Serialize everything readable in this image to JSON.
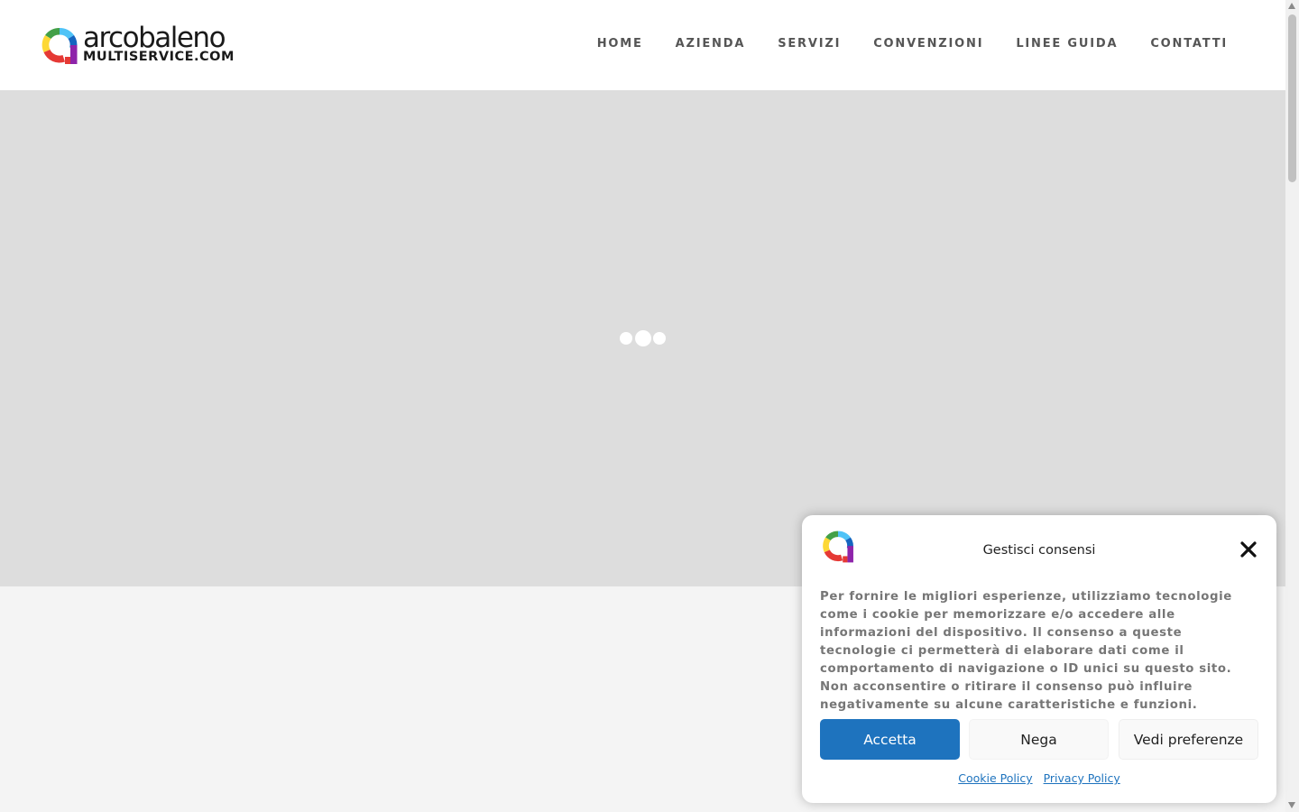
{
  "brand": {
    "name_top": "arcobaleno",
    "name_bottom": "MULTISERVICE.COM",
    "colors": [
      "#e53935",
      "#fdd835",
      "#43a047",
      "#4fc3f7",
      "#1565c0",
      "#8e24aa"
    ]
  },
  "nav": {
    "items": [
      {
        "label": "HOME"
      },
      {
        "label": "AZIENDA"
      },
      {
        "label": "SERVIZI"
      },
      {
        "label": "CONVENZIONI"
      },
      {
        "label": "LINEE GUIDA"
      },
      {
        "label": "CONTATTI"
      }
    ]
  },
  "hero": {
    "background": "#dddddd",
    "loader_icon": "loading-dots-icon"
  },
  "cookie": {
    "title": "Gestisci consensi",
    "body": "Per fornire le migliori esperienze, utilizziamo tecnologie come i cookie per memorizzare e/o accedere alle informazioni del dispositivo. Il consenso a queste tecnologie ci permetterà di elaborare dati come il comportamento di navigazione o ID unici su questo sito. Non acconsentire o ritirare il consenso può influire negativamente su alcune caratteristiche e funzioni.",
    "accept_label": "Accetta",
    "deny_label": "Nega",
    "prefs_label": "Vedi preferenze",
    "cookie_policy_label": "Cookie Policy",
    "privacy_policy_label": "Privacy Policy",
    "accent": "#1e73be",
    "close_icon": "close-icon"
  }
}
